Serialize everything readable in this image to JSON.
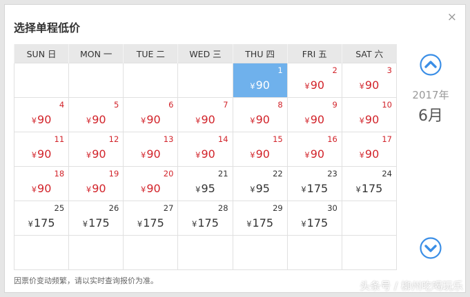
{
  "dialog": {
    "title": "选择单程低价",
    "close_label": "×",
    "notice": "因票价变动频繁，请以实时查询报价为准。"
  },
  "calendar": {
    "year_label": "2017年",
    "month_label": "6月",
    "currency": "¥",
    "weekdays": [
      "SUN 日",
      "MON 一",
      "TUE 二",
      "WED 三",
      "THU 四",
      "FRI 五",
      "SAT 六"
    ],
    "weeks": [
      [
        null,
        null,
        null,
        null,
        {
          "day": "1",
          "price": "90",
          "state": "selected"
        },
        {
          "day": "2",
          "price": "90",
          "state": "low"
        },
        {
          "day": "3",
          "price": "90",
          "state": "low"
        }
      ],
      [
        {
          "day": "4",
          "price": "90",
          "state": "low"
        },
        {
          "day": "5",
          "price": "90",
          "state": "low"
        },
        {
          "day": "6",
          "price": "90",
          "state": "low"
        },
        {
          "day": "7",
          "price": "90",
          "state": "low"
        },
        {
          "day": "8",
          "price": "90",
          "state": "low"
        },
        {
          "day": "9",
          "price": "90",
          "state": "low"
        },
        {
          "day": "10",
          "price": "90",
          "state": "low"
        }
      ],
      [
        {
          "day": "11",
          "price": "90",
          "state": "low"
        },
        {
          "day": "12",
          "price": "90",
          "state": "low"
        },
        {
          "day": "13",
          "price": "90",
          "state": "low"
        },
        {
          "day": "14",
          "price": "90",
          "state": "low"
        },
        {
          "day": "15",
          "price": "90",
          "state": "low"
        },
        {
          "day": "16",
          "price": "90",
          "state": "low"
        },
        {
          "day": "17",
          "price": "90",
          "state": "low"
        }
      ],
      [
        {
          "day": "18",
          "price": "90",
          "state": "low"
        },
        {
          "day": "19",
          "price": "90",
          "state": "low"
        },
        {
          "day": "20",
          "price": "90",
          "state": "low"
        },
        {
          "day": "21",
          "price": "95",
          "state": "reg"
        },
        {
          "day": "22",
          "price": "95",
          "state": "reg"
        },
        {
          "day": "23",
          "price": "175",
          "state": "reg"
        },
        {
          "day": "24",
          "price": "175",
          "state": "reg"
        }
      ],
      [
        {
          "day": "25",
          "price": "175",
          "state": "reg"
        },
        {
          "day": "26",
          "price": "175",
          "state": "reg"
        },
        {
          "day": "27",
          "price": "175",
          "state": "reg"
        },
        {
          "day": "28",
          "price": "175",
          "state": "reg"
        },
        {
          "day": "29",
          "price": "175",
          "state": "reg"
        },
        {
          "day": "30",
          "price": "175",
          "state": "reg"
        },
        null
      ],
      [
        null,
        null,
        null,
        null,
        null,
        null,
        null
      ]
    ]
  },
  "colors": {
    "low_price": "#d2232a",
    "selected_bg": "#6fb1ec",
    "nav_icon": "#3a8ee6"
  },
  "watermark": "头条号 / 柳州吃喝玩乐"
}
